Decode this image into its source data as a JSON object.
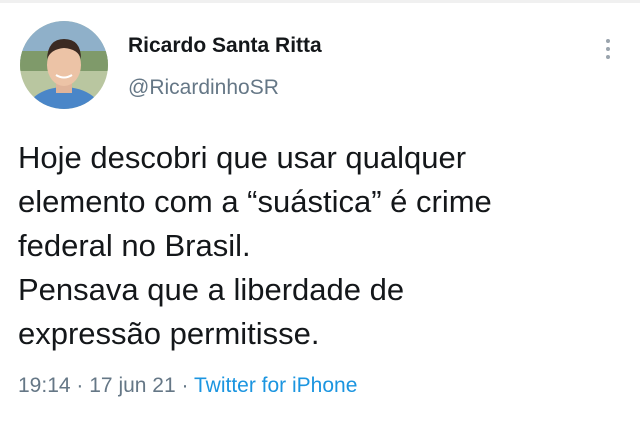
{
  "author": {
    "name": "Ricardo Santa Ritta",
    "handle": "@RicardinhoSR",
    "avatar_icon": "profile-photo"
  },
  "tweet": {
    "lines": [
      "Hoje descobri que usar qualquer",
      "elemento com a “suástica” é crime",
      "federal no Brasil.",
      "Pensava que a liberdade de",
      "expressão permitisse."
    ]
  },
  "meta": {
    "time": "19:14",
    "separator": "·",
    "date": "17 jun 21",
    "source": "Twitter for iPhone"
  },
  "icons": {
    "more": "more-vertical-icon"
  },
  "colors": {
    "text": "#14171a",
    "secondary": "#657786",
    "link": "#1b95e0"
  }
}
